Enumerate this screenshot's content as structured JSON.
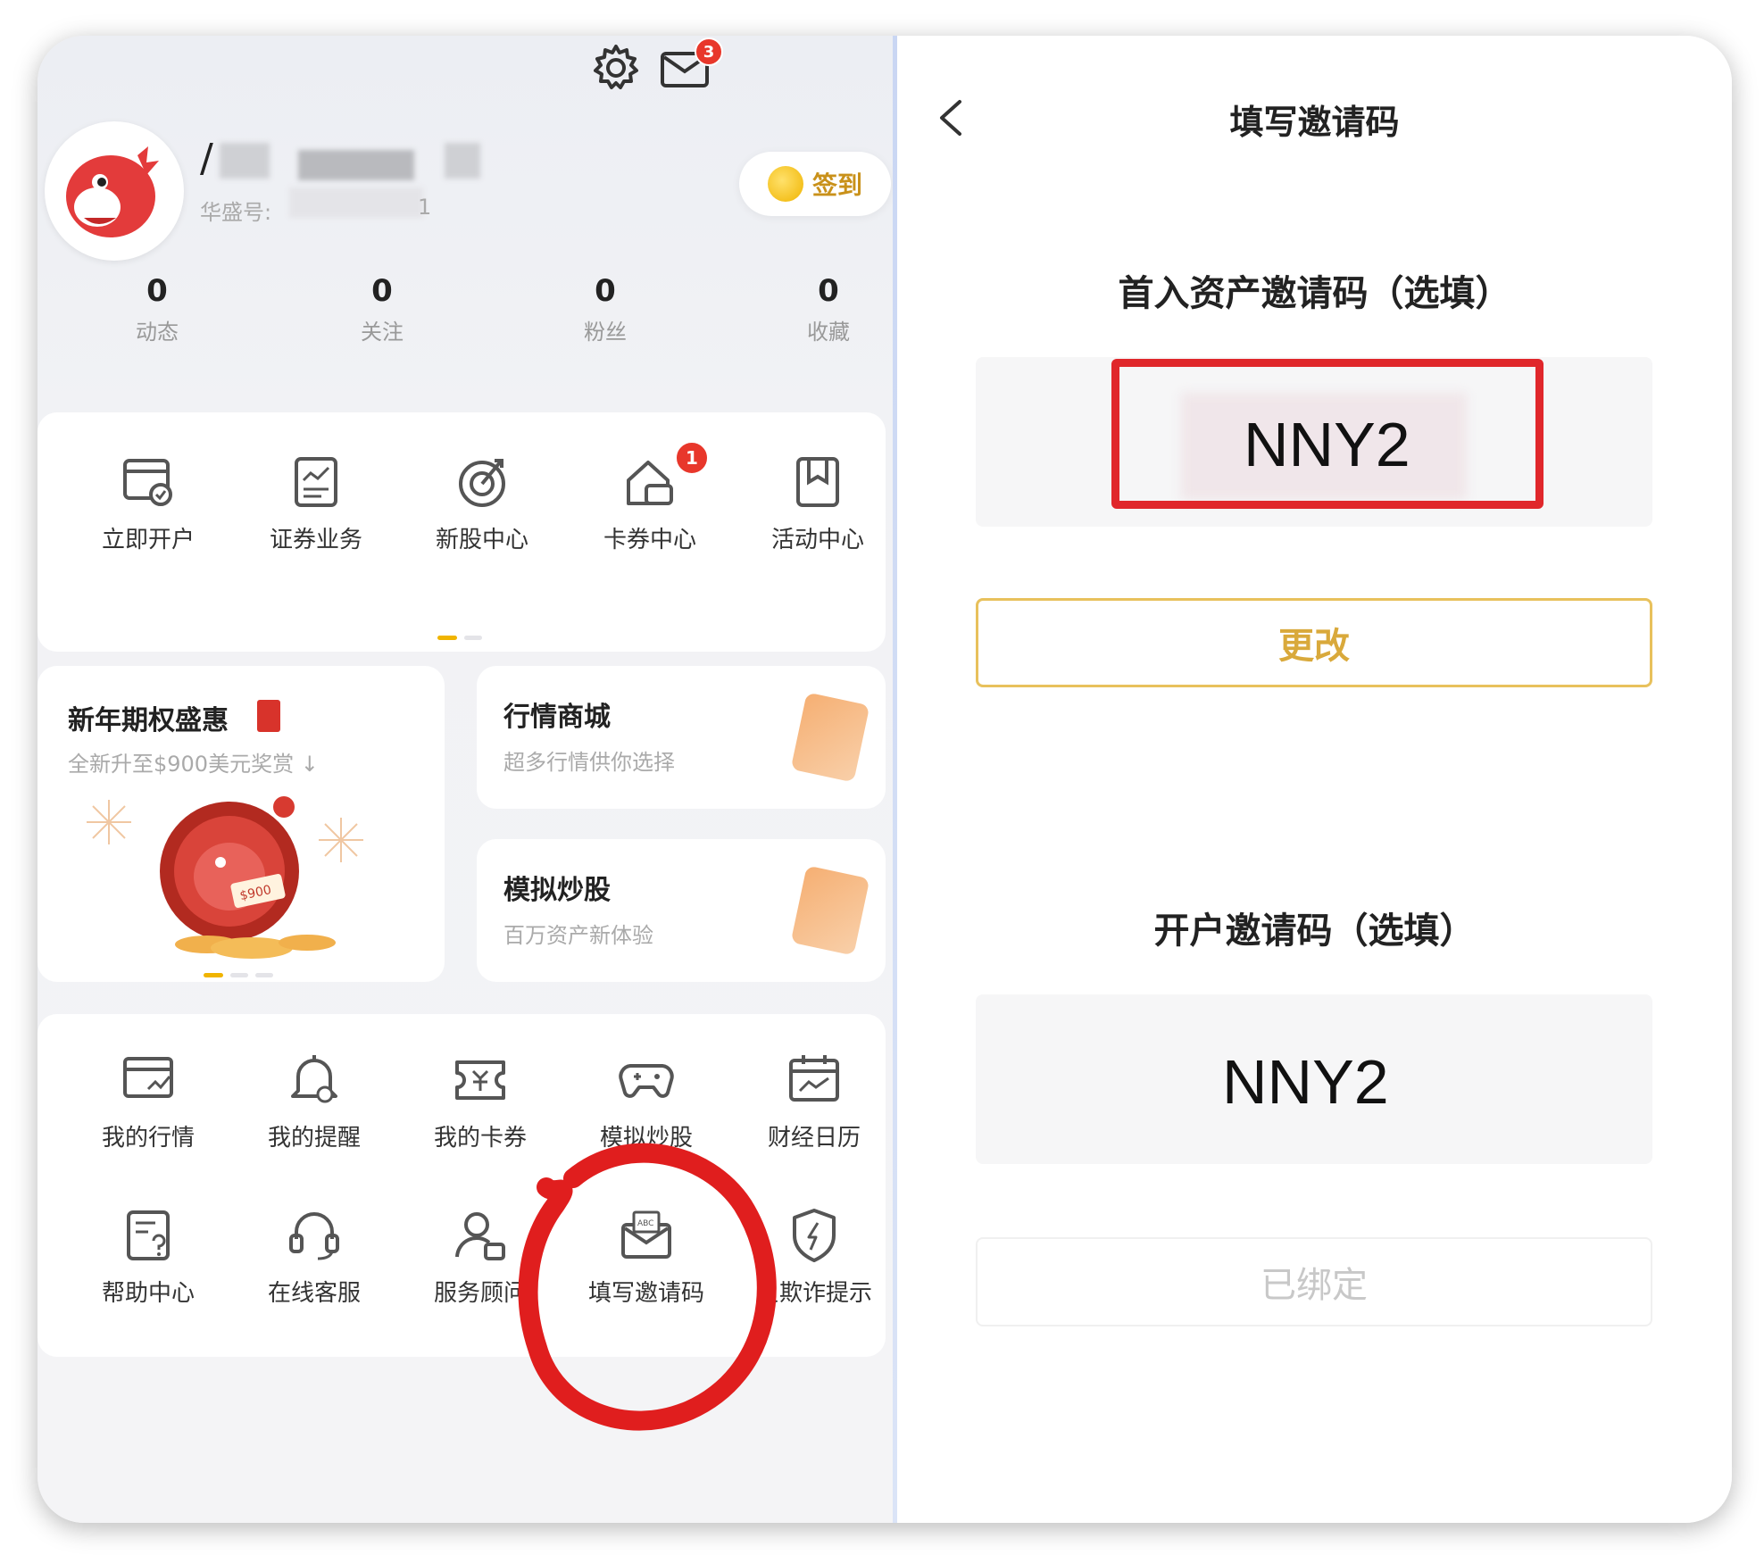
{
  "profile": {
    "name_initial": "/",
    "id_label": "华盛号:",
    "id_tail": "1",
    "signin_label": "签到",
    "mail_badge": "3"
  },
  "stats": [
    {
      "value": "0",
      "label": "动态"
    },
    {
      "value": "0",
      "label": "关注"
    },
    {
      "value": "0",
      "label": "粉丝"
    },
    {
      "value": "0",
      "label": "收藏"
    }
  ],
  "quick_grid": [
    {
      "label": "立即开户",
      "icon": "account-open-icon"
    },
    {
      "label": "证券业务",
      "icon": "securities-icon"
    },
    {
      "label": "新股中心",
      "icon": "ipo-icon"
    },
    {
      "label": "卡券中心",
      "icon": "coupon-icon",
      "badge": "1"
    },
    {
      "label": "活动中心",
      "icon": "bookmark-icon"
    }
  ],
  "promo": {
    "title": "新年期权盛惠",
    "subtitle": "全新升至$900美元奖赏 ↓",
    "coin_label": "$900"
  },
  "side_cards": [
    {
      "title": "行情商城",
      "subtitle": "超多行情供你选择"
    },
    {
      "title": "模拟炒股",
      "subtitle": "百万资产新体验"
    }
  ],
  "tools": [
    {
      "label": "我的行情",
      "icon": "market-icon"
    },
    {
      "label": "我的提醒",
      "icon": "bell-icon"
    },
    {
      "label": "我的卡券",
      "icon": "ticket-icon"
    },
    {
      "label": "模拟炒股",
      "icon": "gamepad-icon"
    },
    {
      "label": "财经日历",
      "icon": "calendar-icon"
    },
    {
      "label": "帮助中心",
      "icon": "help-doc-icon"
    },
    {
      "label": "在线客服",
      "icon": "headset-icon"
    },
    {
      "label": "服务顾问",
      "icon": "advisor-icon"
    },
    {
      "label": "填写邀请码",
      "icon": "invite-mail-icon"
    },
    {
      "label": "反欺诈提示",
      "icon": "shield-icon"
    }
  ],
  "invite_page": {
    "title": "填写邀请码",
    "asset_section": "首入资产邀请码（选填）",
    "asset_code": "NNY2",
    "change_button": "更改",
    "account_section": "开户邀请码（选填）",
    "account_code": "NNY2",
    "bound_button": "已绑定"
  }
}
